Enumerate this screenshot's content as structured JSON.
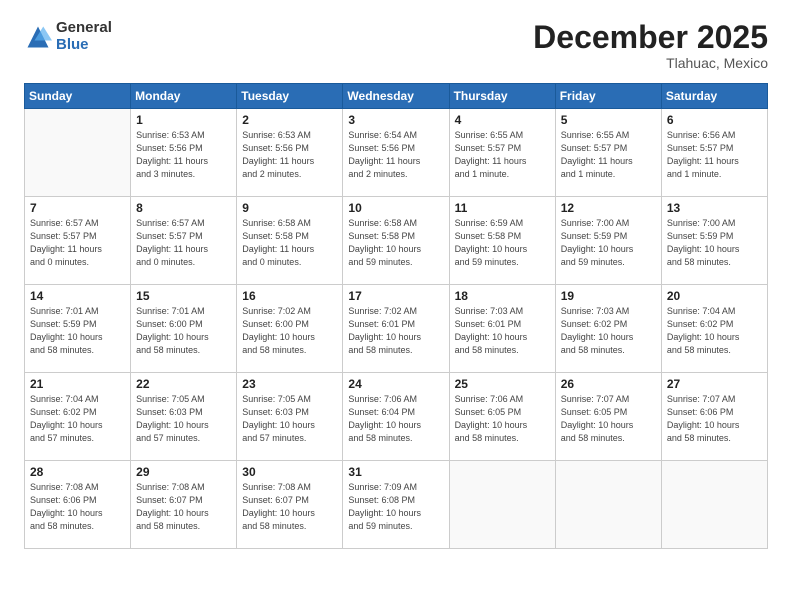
{
  "logo": {
    "general": "General",
    "blue": "Blue"
  },
  "title": "December 2025",
  "location": "Tlahuac, Mexico",
  "days_header": [
    "Sunday",
    "Monday",
    "Tuesday",
    "Wednesday",
    "Thursday",
    "Friday",
    "Saturday"
  ],
  "weeks": [
    [
      {
        "day": "",
        "info": ""
      },
      {
        "day": "1",
        "info": "Sunrise: 6:53 AM\nSunset: 5:56 PM\nDaylight: 11 hours\nand 3 minutes."
      },
      {
        "day": "2",
        "info": "Sunrise: 6:53 AM\nSunset: 5:56 PM\nDaylight: 11 hours\nand 2 minutes."
      },
      {
        "day": "3",
        "info": "Sunrise: 6:54 AM\nSunset: 5:56 PM\nDaylight: 11 hours\nand 2 minutes."
      },
      {
        "day": "4",
        "info": "Sunrise: 6:55 AM\nSunset: 5:57 PM\nDaylight: 11 hours\nand 1 minute."
      },
      {
        "day": "5",
        "info": "Sunrise: 6:55 AM\nSunset: 5:57 PM\nDaylight: 11 hours\nand 1 minute."
      },
      {
        "day": "6",
        "info": "Sunrise: 6:56 AM\nSunset: 5:57 PM\nDaylight: 11 hours\nand 1 minute."
      }
    ],
    [
      {
        "day": "7",
        "info": "Sunrise: 6:57 AM\nSunset: 5:57 PM\nDaylight: 11 hours\nand 0 minutes."
      },
      {
        "day": "8",
        "info": "Sunrise: 6:57 AM\nSunset: 5:57 PM\nDaylight: 11 hours\nand 0 minutes."
      },
      {
        "day": "9",
        "info": "Sunrise: 6:58 AM\nSunset: 5:58 PM\nDaylight: 11 hours\nand 0 minutes."
      },
      {
        "day": "10",
        "info": "Sunrise: 6:58 AM\nSunset: 5:58 PM\nDaylight: 10 hours\nand 59 minutes."
      },
      {
        "day": "11",
        "info": "Sunrise: 6:59 AM\nSunset: 5:58 PM\nDaylight: 10 hours\nand 59 minutes."
      },
      {
        "day": "12",
        "info": "Sunrise: 7:00 AM\nSunset: 5:59 PM\nDaylight: 10 hours\nand 59 minutes."
      },
      {
        "day": "13",
        "info": "Sunrise: 7:00 AM\nSunset: 5:59 PM\nDaylight: 10 hours\nand 58 minutes."
      }
    ],
    [
      {
        "day": "14",
        "info": "Sunrise: 7:01 AM\nSunset: 5:59 PM\nDaylight: 10 hours\nand 58 minutes."
      },
      {
        "day": "15",
        "info": "Sunrise: 7:01 AM\nSunset: 6:00 PM\nDaylight: 10 hours\nand 58 minutes."
      },
      {
        "day": "16",
        "info": "Sunrise: 7:02 AM\nSunset: 6:00 PM\nDaylight: 10 hours\nand 58 minutes."
      },
      {
        "day": "17",
        "info": "Sunrise: 7:02 AM\nSunset: 6:01 PM\nDaylight: 10 hours\nand 58 minutes."
      },
      {
        "day": "18",
        "info": "Sunrise: 7:03 AM\nSunset: 6:01 PM\nDaylight: 10 hours\nand 58 minutes."
      },
      {
        "day": "19",
        "info": "Sunrise: 7:03 AM\nSunset: 6:02 PM\nDaylight: 10 hours\nand 58 minutes."
      },
      {
        "day": "20",
        "info": "Sunrise: 7:04 AM\nSunset: 6:02 PM\nDaylight: 10 hours\nand 58 minutes."
      }
    ],
    [
      {
        "day": "21",
        "info": "Sunrise: 7:04 AM\nSunset: 6:02 PM\nDaylight: 10 hours\nand 57 minutes."
      },
      {
        "day": "22",
        "info": "Sunrise: 7:05 AM\nSunset: 6:03 PM\nDaylight: 10 hours\nand 57 minutes."
      },
      {
        "day": "23",
        "info": "Sunrise: 7:05 AM\nSunset: 6:03 PM\nDaylight: 10 hours\nand 57 minutes."
      },
      {
        "day": "24",
        "info": "Sunrise: 7:06 AM\nSunset: 6:04 PM\nDaylight: 10 hours\nand 58 minutes."
      },
      {
        "day": "25",
        "info": "Sunrise: 7:06 AM\nSunset: 6:05 PM\nDaylight: 10 hours\nand 58 minutes."
      },
      {
        "day": "26",
        "info": "Sunrise: 7:07 AM\nSunset: 6:05 PM\nDaylight: 10 hours\nand 58 minutes."
      },
      {
        "day": "27",
        "info": "Sunrise: 7:07 AM\nSunset: 6:06 PM\nDaylight: 10 hours\nand 58 minutes."
      }
    ],
    [
      {
        "day": "28",
        "info": "Sunrise: 7:08 AM\nSunset: 6:06 PM\nDaylight: 10 hours\nand 58 minutes."
      },
      {
        "day": "29",
        "info": "Sunrise: 7:08 AM\nSunset: 6:07 PM\nDaylight: 10 hours\nand 58 minutes."
      },
      {
        "day": "30",
        "info": "Sunrise: 7:08 AM\nSunset: 6:07 PM\nDaylight: 10 hours\nand 58 minutes."
      },
      {
        "day": "31",
        "info": "Sunrise: 7:09 AM\nSunset: 6:08 PM\nDaylight: 10 hours\nand 59 minutes."
      },
      {
        "day": "",
        "info": ""
      },
      {
        "day": "",
        "info": ""
      },
      {
        "day": "",
        "info": ""
      }
    ]
  ]
}
